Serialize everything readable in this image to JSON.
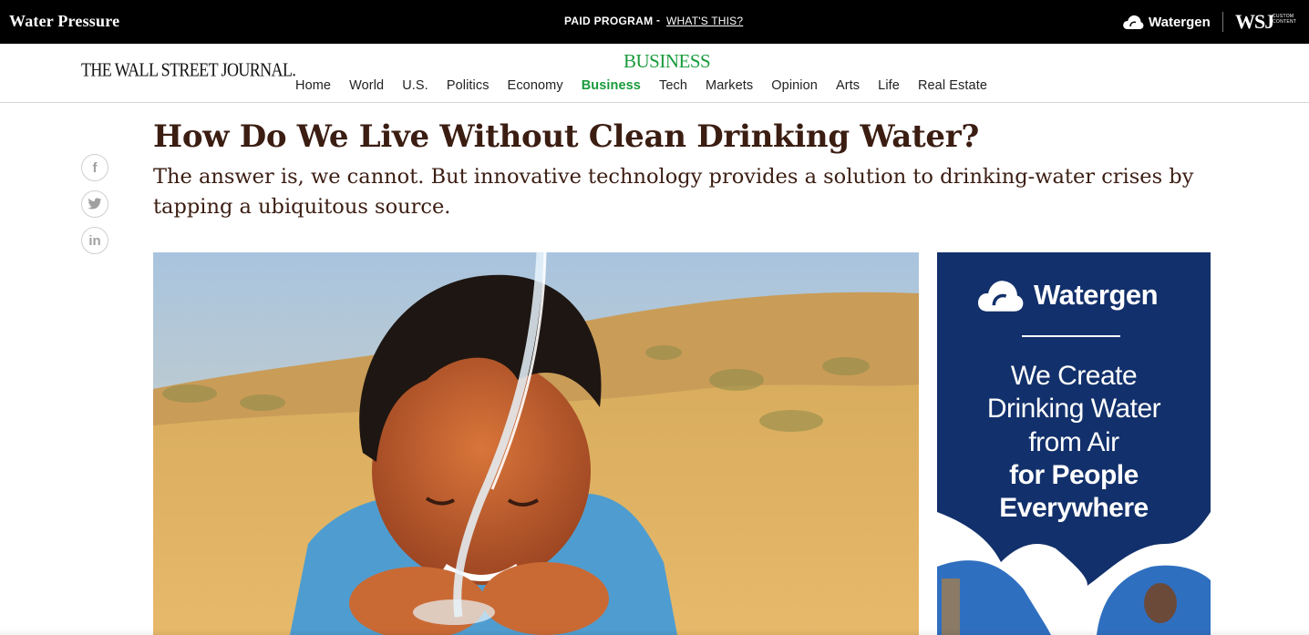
{
  "topbar": {
    "title": "Water Pressure",
    "paid_label": "PAID PROGRAM",
    "separator": "-",
    "whats_this": "WHAT'S THIS?",
    "sponsor": "Watergen",
    "wsj": "WSJ",
    "custom_content": "CUSTOM CONTENT"
  },
  "header": {
    "logo": "THE WALL STREET JOURNAL.",
    "section": "BUSINESS",
    "nav": [
      "Home",
      "World",
      "U.S.",
      "Politics",
      "Economy",
      "Business",
      "Tech",
      "Markets",
      "Opinion",
      "Arts",
      "Life",
      "Real Estate"
    ],
    "active_nav": "Business"
  },
  "article": {
    "headline": "How Do We Live Without Clean Drinking Water?",
    "dek": "The answer is, we cannot. But innovative technology provides a solution to drinking-water crises by tapping a ubiquitous source."
  },
  "share": {
    "facebook": "f",
    "twitter": "twitter-bird",
    "linkedin": "in"
  },
  "ad": {
    "brand": "Watergen",
    "line1": "We Create",
    "line2": "Drinking Water",
    "line3": "from Air",
    "line4": "for People",
    "line5": "Everywhere"
  },
  "colors": {
    "accent_green": "#1a9b3c",
    "headline": "#3b1d12",
    "ad_navy": "#12306b",
    "topbar": "#000000"
  }
}
